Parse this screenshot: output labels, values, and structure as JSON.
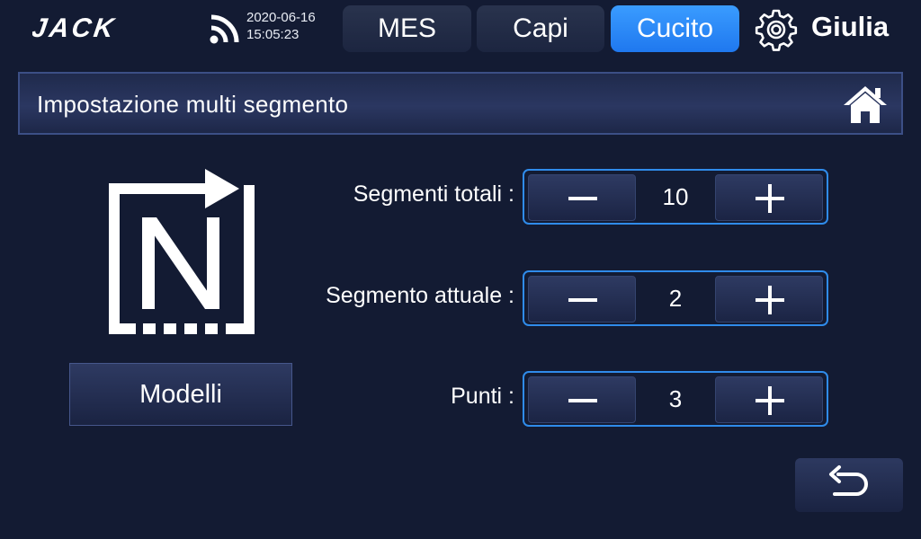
{
  "header": {
    "logo_text": "JACK",
    "date": "2020-06-16",
    "time": "15:05:23",
    "tabs": [
      {
        "label": "MES",
        "active": false
      },
      {
        "label": "Capi",
        "active": false
      },
      {
        "label": "Cucito",
        "active": true
      }
    ],
    "user": "Giulia",
    "icons": [
      "wifi-icon",
      "gear-icon"
    ]
  },
  "page": {
    "title": "Impostazione multi segmento",
    "home_icon": "home-icon"
  },
  "left_panel": {
    "icon": "n-segment-icon",
    "models_button": "Modelli"
  },
  "settings": [
    {
      "label": "Segmenti totali :",
      "value": "10"
    },
    {
      "label": "Segmento attuale :",
      "value": "2"
    },
    {
      "label": "Punti :",
      "value": "3"
    }
  ],
  "footer": {
    "back_icon": "back-arrow-icon"
  },
  "colors": {
    "background": "#131b33",
    "accent": "#2f8bea",
    "active_tab": "#2a8aff"
  }
}
